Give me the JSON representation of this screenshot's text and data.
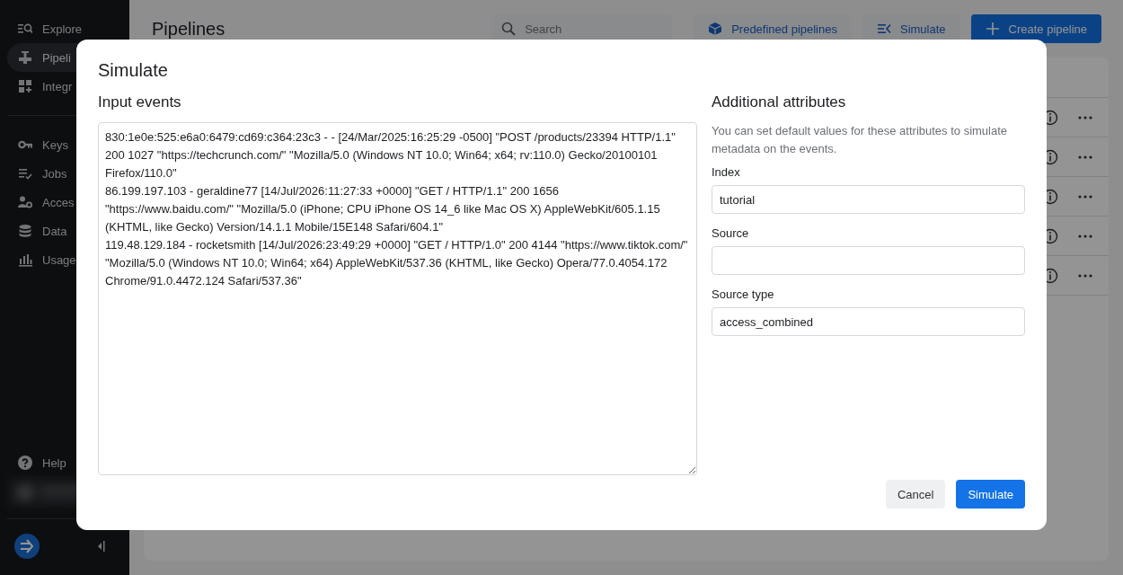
{
  "sidebar": {
    "items": [
      {
        "label": "Explore",
        "selected": false
      },
      {
        "label": "Pipeli",
        "selected": true
      },
      {
        "label": "Integr",
        "selected": false
      }
    ],
    "items_2": [
      {
        "label": "Keys",
        "selected": false
      },
      {
        "label": "Jobs",
        "selected": false
      },
      {
        "label": "Acces",
        "selected": false
      },
      {
        "label": "Data",
        "selected": false
      },
      {
        "label": "Usage",
        "selected": false
      }
    ],
    "help": "Help"
  },
  "page": {
    "title": "Pipelines",
    "search": {
      "placeholder": "Search"
    },
    "buttons": [
      {
        "label": "Predefined pipelines",
        "kind": "secondary"
      },
      {
        "label": "Simulate",
        "kind": "secondary"
      },
      {
        "label": "Create pipeline",
        "kind": "primary"
      }
    ]
  },
  "dialog": {
    "title": "Simulate",
    "input_events": {
      "label": "Input events",
      "events": [
        "830:1e0e:525:e6a0:6479:cd69:c364:23c3 - - [24/Mar/2025:16:25:29 -0500] \"POST /products/23394 HTTP/1.1\" 200 1027 \"https://techcrunch.com/\" \"Mozilla/5.0 (Windows NT 10.0; Win64; x64; rv:110.0) Gecko/20100101 Firefox/110.0\"",
        "86.199.197.103 - geraldine77 [14/Jul/2026:11:27:33 +0000] \"GET / HTTP/1.1\" 200 1656 \"https://www.baidu.com/\" \"Mozilla/5.0 (iPhone; CPU iPhone OS 14_6 like Mac OS X) AppleWebKit/605.1.15 (KHTML, like Gecko) Version/14.1.1 Mobile/15E148 Safari/604.1\"",
        "119.48.129.184 - rocketsmith [14/Jul/2026:23:49:29 +0000] \"GET / HTTP/1.0\" 200 4144 \"https://www.tiktok.com/\" \"Mozilla/5.0 (Windows NT 10.0; Win64; x64) AppleWebKit/537.36 (KHTML, like Gecko) Opera/77.0.4054.172 Chrome/91.0.4472.124 Safari/537.36\""
      ]
    },
    "attributes": {
      "title": "Additional attributes",
      "description": "You can set default values for these attributes to simulate metadata on the events.",
      "fields": [
        {
          "label": "Index",
          "value": "tutorial"
        },
        {
          "label": "Source"
        },
        {
          "label": "Source type",
          "value": "access_combined"
        }
      ]
    },
    "buttons": [
      {
        "label": "Cancel",
        "kind": "secondary"
      },
      {
        "label": "Simulate",
        "kind": "primary"
      }
    ]
  }
}
